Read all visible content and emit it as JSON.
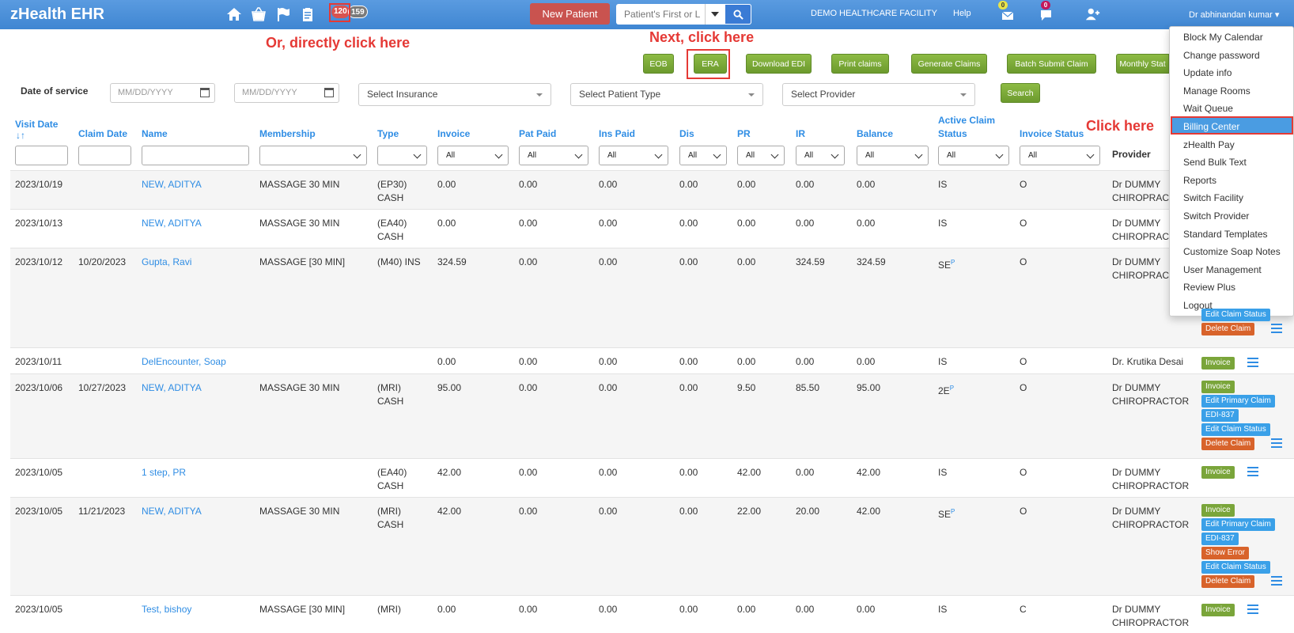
{
  "navbar": {
    "brand": "zHealth EHR",
    "icons": [
      "home-icon",
      "basket-icon",
      "flag-icon",
      "clipboard-icon"
    ],
    "badge_red": "120",
    "badge_gray": "159",
    "new_patient_label": "New Patient",
    "search_placeholder": "Patient's First or L",
    "facility": "DEMO HEALTHCARE FACILITY",
    "help": "Help",
    "mail_count": "0",
    "chat_count": "0",
    "user": "Dr abhinandan kumar"
  },
  "annotations": {
    "direct": "Or, directly click here",
    "next": "Next, click here",
    "click": "Click here"
  },
  "toolbar": {
    "eob": "EOB",
    "era": "ERA",
    "download_edi": "Download EDI",
    "print_claims": "Print claims",
    "generate_claims": "Generate Claims",
    "batch_submit": "Batch Submit Claim",
    "monthly": "Monthly Stat"
  },
  "filters": {
    "date_label": "Date of service",
    "date_placeholder": "MM/DD/YYYY",
    "insurance": "Select Insurance",
    "patient_type": "Select Patient Type",
    "provider": "Select Provider",
    "search": "Search"
  },
  "columns": {
    "visit_date": "Visit Date",
    "claim_date": "Claim Date",
    "name": "Name",
    "membership": "Membership",
    "type": "Type",
    "invoice": "Invoice",
    "pat_paid": "Pat Paid",
    "ins_paid": "Ins Paid",
    "dis": "Dis",
    "pr": "PR",
    "ir": "IR",
    "balance": "Balance",
    "active_claim_1": "Active Claim",
    "active_claim_2": "Status",
    "invoice_status": "Invoice Status",
    "provider": "Provider",
    "all": "All"
  },
  "rows": [
    {
      "visit": "2023/10/19",
      "claim": "",
      "name": "NEW, ADITYA",
      "membership": "MASSAGE 30 MIN",
      "type1": "(EP30)",
      "type2": "CASH",
      "invoice": "0.00",
      "pat": "0.00",
      "ins": "0.00",
      "dis": "0.00",
      "pr": "0.00",
      "ir": "0.00",
      "balance": "0.00",
      "status": "IS",
      "sup": "",
      "inv_status": "O",
      "prov1": "Dr DUMMY",
      "prov2": "CHIROPRACTOR"
    },
    {
      "visit": "2023/10/13",
      "claim": "",
      "name": "NEW, ADITYA",
      "membership": "MASSAGE 30 MIN",
      "type1": "(EA40)",
      "type2": "CASH",
      "invoice": "0.00",
      "pat": "0.00",
      "ins": "0.00",
      "dis": "0.00",
      "pr": "0.00",
      "ir": "0.00",
      "balance": "0.00",
      "status": "IS",
      "sup": "",
      "inv_status": "O",
      "prov1": "Dr DUMMY",
      "prov2": "CHIROPRACTOR"
    },
    {
      "visit": "2023/10/12",
      "claim": "10/20/2023",
      "name": "Gupta, Ravi",
      "membership": "MASSAGE [30 MIN]",
      "type1": "(M40) INS",
      "type2": "",
      "invoice": "324.59",
      "pat": "0.00",
      "ins": "0.00",
      "dis": "0.00",
      "pr": "0.00",
      "ir": "324.59",
      "balance": "324.59",
      "status": "SE",
      "sup": "P",
      "inv_status": "O",
      "prov1": "Dr DUMMY",
      "prov2": "CHIROPRACTOR"
    },
    {
      "visit": "2023/10/11",
      "claim": "",
      "name": "DelEncounter, Soap",
      "membership": "",
      "type1": "",
      "type2": "",
      "invoice": "0.00",
      "pat": "0.00",
      "ins": "0.00",
      "dis": "0.00",
      "pr": "0.00",
      "ir": "0.00",
      "balance": "0.00",
      "status": "IS",
      "sup": "",
      "inv_status": "O",
      "prov1": "Dr. Krutika Desai",
      "prov2": ""
    },
    {
      "visit": "2023/10/06",
      "claim": "10/27/2023",
      "name": "NEW, ADITYA",
      "membership": "MASSAGE 30 MIN",
      "type1": "(MRI)",
      "type2": "CASH",
      "invoice": "95.00",
      "pat": "0.00",
      "ins": "0.00",
      "dis": "0.00",
      "pr": "9.50",
      "ir": "85.50",
      "balance": "95.00",
      "status": "2E",
      "sup": "P",
      "inv_status": "O",
      "prov1": "Dr DUMMY",
      "prov2": "CHIROPRACTOR"
    },
    {
      "visit": "2023/10/05",
      "claim": "",
      "name": "1 step, PR",
      "membership": "",
      "type1": "(EA40)",
      "type2": "CASH",
      "invoice": "42.00",
      "pat": "0.00",
      "ins": "0.00",
      "dis": "0.00",
      "pr": "42.00",
      "ir": "0.00",
      "balance": "42.00",
      "status": "IS",
      "sup": "",
      "inv_status": "O",
      "prov1": "Dr DUMMY",
      "prov2": "CHIROPRACTOR"
    },
    {
      "visit": "2023/10/05",
      "claim": "11/21/2023",
      "name": "NEW, ADITYA",
      "membership": "MASSAGE 30 MIN",
      "type1": "(MRI)",
      "type2": "CASH",
      "invoice": "42.00",
      "pat": "0.00",
      "ins": "0.00",
      "dis": "0.00",
      "pr": "22.00",
      "ir": "20.00",
      "balance": "42.00",
      "status": "SE",
      "sup": "P",
      "inv_status": "O",
      "prov1": "Dr DUMMY",
      "prov2": "CHIROPRACTOR"
    },
    {
      "visit": "2023/10/05",
      "claim": "",
      "name": "Test, bishoy",
      "membership": "MASSAGE [30 MIN]",
      "type1": "(MRI)",
      "type2": "",
      "invoice": "0.00",
      "pat": "0.00",
      "ins": "0.00",
      "dis": "0.00",
      "pr": "0.00",
      "ir": "0.00",
      "balance": "0.00",
      "status": "IS",
      "sup": "",
      "inv_status": "C",
      "prov1": "Dr DUMMY",
      "prov2": "CHIROPRACTOR"
    }
  ],
  "actions": {
    "invoice": "Invoice",
    "edit_primary": "Edit Primary Claim",
    "edi": "EDI-837",
    "edit_status": "Edit Claim Status",
    "delete": "Delete Claim",
    "show_error": "Show Error"
  },
  "menu": [
    "Block My Calendar",
    "Change password",
    "Update info",
    "Manage Rooms",
    "Wait Queue",
    "Billing Center",
    "zHealth Pay",
    "Send Bulk Text",
    "Reports",
    "Switch Facility",
    "Switch Provider",
    "Standard Templates",
    "Customize Soap Notes",
    "User Management",
    "Review Plus",
    "Logout"
  ],
  "colors": {
    "navbar": "#4a90d9",
    "green": "#7aa53a",
    "annotation": "#e53935",
    "link": "#2f8de4"
  }
}
